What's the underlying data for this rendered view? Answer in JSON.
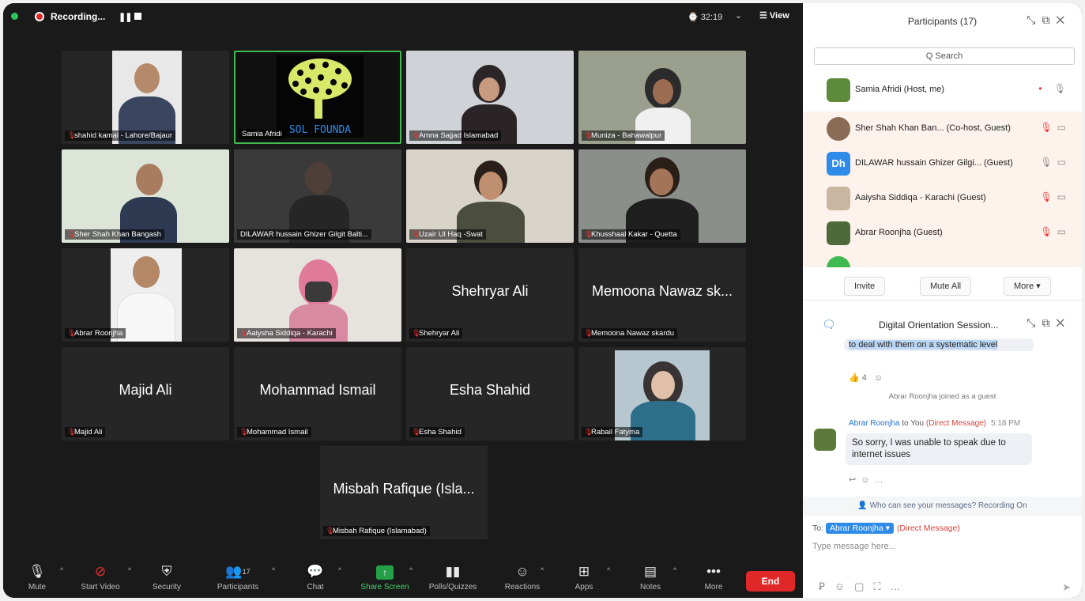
{
  "topbar": {
    "recording_label": "Recording...",
    "pause_icon": "❚❚",
    "timer": "⌚ 32:19",
    "timer_caret": "⌄",
    "view_label": "☰ View"
  },
  "tiles": [
    {
      "caption": "shahid kamal - Lahore/Bajaur",
      "bigname": ""
    },
    {
      "caption": "Samia Afridi",
      "bigname": "",
      "logo_text": "SOL FOUNDA"
    },
    {
      "caption": "Amna Sajjad Islamabad",
      "bigname": ""
    },
    {
      "caption": "Muniza - Bahawalpur",
      "bigname": ""
    },
    {
      "caption": "Sher Shah Khan Bangash",
      "bigname": ""
    },
    {
      "caption": "DILAWAR hussain Ghizer Gilgit Balti...",
      "bigname": ""
    },
    {
      "caption": "Uzair Ul Haq -Swat",
      "bigname": ""
    },
    {
      "caption": "Khusshaal Kakar - Quetta",
      "bigname": ""
    },
    {
      "caption": "Abrar Roonjha",
      "bigname": ""
    },
    {
      "caption": "Aaiysha Siddiqa - Karachi",
      "bigname": ""
    },
    {
      "caption": "Shehryar Ali",
      "bigname": "Shehryar Ali"
    },
    {
      "caption": "Memoona Nawaz skardu",
      "bigname": "Memoona Nawaz sk..."
    },
    {
      "caption": "Majid Ali",
      "bigname": "Majid Ali"
    },
    {
      "caption": "Mohammad Ismail",
      "bigname": "Mohammad Ismail"
    },
    {
      "caption": "Esha Shahid",
      "bigname": "Esha Shahid"
    },
    {
      "caption": "Rabail Fatyma",
      "bigname": ""
    },
    {
      "caption": "Misbah Rafique (Islamabad)",
      "bigname": "Misbah Rafique (Isla..."
    }
  ],
  "toolbar": {
    "mute": "Mute",
    "start_video": "Start Video",
    "security": "Security",
    "participants": "Participants",
    "participants_count": "17",
    "chat": "Chat",
    "share_screen": "Share Screen",
    "polls": "Polls/Quizzes",
    "reactions": "Reactions",
    "apps": "Apps",
    "notes": "Notes",
    "more": "More",
    "end": "End"
  },
  "participants_panel": {
    "title": "Participants (17)",
    "search_placeholder": "Q Search",
    "rows": [
      {
        "name": "Samia Afridi (Host, me)",
        "status": "•  🎙"
      },
      {
        "name": "Sher Shah Khan Ban... (Co-host, Guest)",
        "status": "🎙 ▭"
      },
      {
        "name": "DILAWAR hussain Ghizer Gilgi... (Guest)",
        "status": "🎙 ▭",
        "initials": "Dh"
      },
      {
        "name": "Aaiysha Siddiqa - Karachi (Guest)",
        "status": "🎙 ▭"
      },
      {
        "name": "Abrar Roonjha (Guest)",
        "status": "🎙 ▭"
      }
    ],
    "invite": "Invite",
    "mute_all": "Mute All",
    "more": "More ▾"
  },
  "chat": {
    "title": "Digital Orientation Session...",
    "prev_message_tail": "to deal with them on a systematic level",
    "reaction": "👍 4",
    "joined_notice": "Abrar Roonjha joined as a guest",
    "dm_sender": "Abrar Roonjha",
    "dm_to": "to You",
    "dm_tag": "(Direct Message)",
    "dm_time": "5:18 PM",
    "dm_text": "So sorry, I was unable to speak due to internet issues",
    "privacy_notice": "👤 Who can see your messages? Recording On",
    "to_label": "To:",
    "to_recipient": "Abrar Roonjha ▾",
    "to_tag": "(Direct Message)",
    "compose_placeholder": "Type message here..."
  }
}
